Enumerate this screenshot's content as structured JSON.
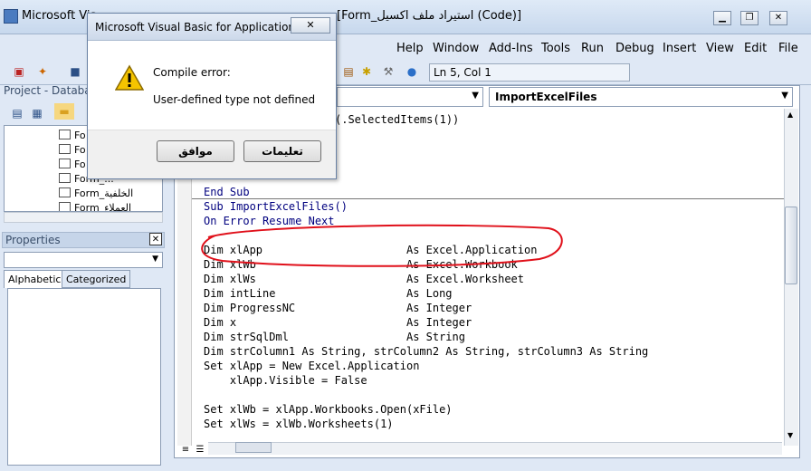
{
  "window": {
    "title": "Microsoft Visual Basic for Applications",
    "title_suffix": "[Form_استيراد ملف اكسيل (Code)]",
    "title_short": "Microsoft Vis"
  },
  "menu": [
    {
      "label": "Help"
    },
    {
      "label": "Window"
    },
    {
      "label": "Add-Ins"
    },
    {
      "label": "Tools"
    },
    {
      "label": "Run"
    },
    {
      "label": "Debug"
    },
    {
      "label": "Insert"
    },
    {
      "label": "View"
    },
    {
      "label": "Edit"
    },
    {
      "label": "File"
    }
  ],
  "toolbar": {
    "position": "Ln 5, Col 1"
  },
  "project": {
    "title": "Project - Databas",
    "items": [
      "Fo",
      "Fo",
      "Fo",
      "Form_...",
      "Form_الخلفية",
      "Form_العملاء"
    ]
  },
  "properties": {
    "title": "Properties",
    "tabs": [
      {
        "label": "Alphabetic"
      },
      {
        "label": "Categorized"
      }
    ]
  },
  "code_window": {
    "proc_combo": "ImportExcelFiles",
    "lines": [
      {
        "text": "(.SelectedItems(1))"
      },
      {
        "text": "End Sub"
      },
      {
        "text": "Sub ImportExcelFiles()"
      },
      {
        "text": "On Error Resume Next"
      },
      {
        "text": ""
      },
      {
        "text": "Dim xlApp                      As Excel.Application"
      },
      {
        "text": "Dim xlWb                       As Excel.Workbook"
      },
      {
        "text": "Dim xlWs                       As Excel.Worksheet"
      },
      {
        "text": "Dim intLine                    As Long"
      },
      {
        "text": "Dim ProgressNC                 As Integer"
      },
      {
        "text": "Dim x                          As Integer"
      },
      {
        "text": "Dim strSqlDml                  As String"
      },
      {
        "text": "Dim strColumn1 As String, strColumn2 As String, strColumn3 As String"
      },
      {
        "text": "Set xlApp = New Excel.Application"
      },
      {
        "text": "    xlApp.Visible = False"
      },
      {
        "text": ""
      },
      {
        "text": "Set xlWb = xlApp.Workbooks.Open(xFile)"
      },
      {
        "text": "Set xlWs = xlWb.Worksheets(1)"
      }
    ]
  },
  "dialog": {
    "title": "Microsoft Visual Basic for Applications",
    "message_title": "Compile error:",
    "message": "User-defined type not defined",
    "ok_label": "موافق",
    "help_label": "تعليمات",
    "icon": "warning-icon"
  },
  "colors": {
    "keyword": "#00007f",
    "annotation": "#e0101a"
  }
}
